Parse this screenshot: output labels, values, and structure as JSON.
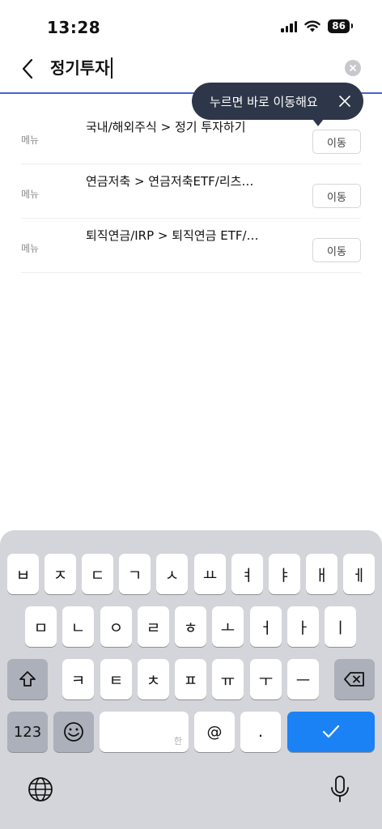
{
  "status_bar": {
    "time": "13:28",
    "battery": "86"
  },
  "search": {
    "query": "정기투자"
  },
  "tooltip": {
    "text": "누르면 바로 이동해요"
  },
  "results": [
    {
      "category": "메뉴",
      "path": "국내/해외주식 > 정기 투자하기",
      "button": "이동"
    },
    {
      "category": "메뉴",
      "path": "연금저축 > 연금저축ETF/리츠…",
      "button": "이동"
    },
    {
      "category": "메뉴",
      "path": "퇴직연금/IRP > 퇴직연금 ETF/…",
      "button": "이동"
    }
  ],
  "keyboard": {
    "row1": [
      "ㅂ",
      "ㅈ",
      "ㄷ",
      "ㄱ",
      "ㅅ",
      "ㅛ",
      "ㅕ",
      "ㅑ",
      "ㅐ",
      "ㅔ"
    ],
    "row2": [
      "ㅁ",
      "ㄴ",
      "ㅇ",
      "ㄹ",
      "ㅎ",
      "ㅗ",
      "ㅓ",
      "ㅏ",
      "ㅣ"
    ],
    "row3": [
      "ㅋ",
      "ㅌ",
      "ㅊ",
      "ㅍ",
      "ㅠ",
      "ㅜ",
      "ㅡ"
    ],
    "numbers_label": "123",
    "space_hint": "한",
    "at_label": "@",
    "period_label": "."
  },
  "colors": {
    "accent": "#1a82f5",
    "divider": "#4b62c9",
    "tooltip_bg": "#2e3749"
  },
  "icons": [
    "back-arrow-icon",
    "clear-icon",
    "close-icon",
    "shift-icon",
    "delete-icon",
    "emoji-icon",
    "globe-icon",
    "microphone-icon",
    "checkmark-icon",
    "wifi-icon",
    "signal-icon"
  ]
}
